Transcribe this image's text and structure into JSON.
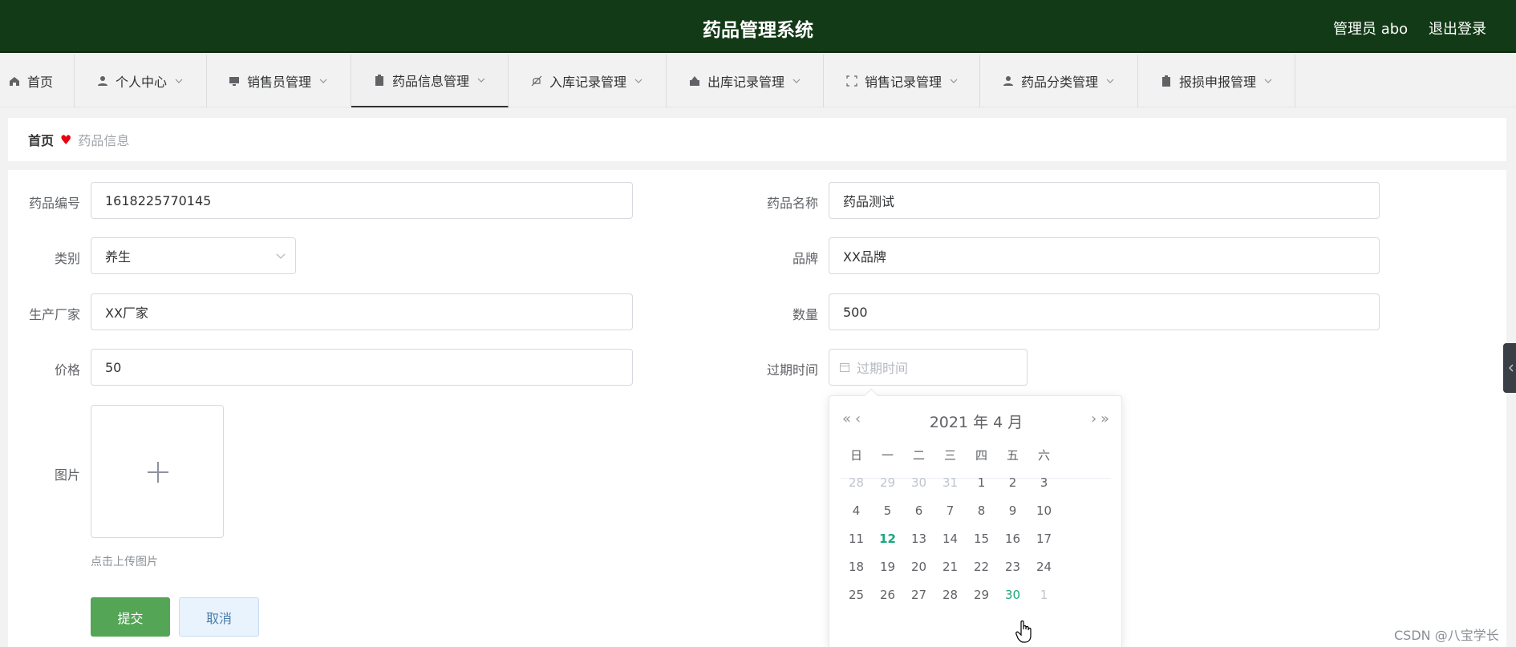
{
  "header": {
    "title": "药品管理系统",
    "user": "管理员 abo",
    "logout": "退出登录"
  },
  "nav": {
    "items": [
      {
        "label": "首页",
        "icon": "home-icon"
      },
      {
        "label": "个人中心",
        "icon": "user-icon"
      },
      {
        "label": "销售员管理",
        "icon": "monitor-icon"
      },
      {
        "label": "药品信息管理",
        "icon": "clipboard-icon"
      },
      {
        "label": "入库记录管理",
        "icon": "bell-off-icon"
      },
      {
        "label": "出库记录管理",
        "icon": "box-icon"
      },
      {
        "label": "销售记录管理",
        "icon": "fullscreen-icon"
      },
      {
        "label": "药品分类管理",
        "icon": "user-icon"
      },
      {
        "label": "报损申报管理",
        "icon": "clipboard-icon"
      }
    ]
  },
  "breadcrumb": {
    "home": "首页",
    "current": "药品信息"
  },
  "form": {
    "code_label": "药品编号",
    "code_value": "1618225770145",
    "name_label": "药品名称",
    "name_value": "药品测试",
    "category_label": "类别",
    "category_value": "养生",
    "brand_label": "品牌",
    "brand_value": "XX品牌",
    "maker_label": "生产厂家",
    "maker_value": "XX厂家",
    "qty_label": "数量",
    "qty_value": "500",
    "price_label": "价格",
    "price_value": "50",
    "expire_label": "过期时间",
    "expire_placeholder": "过期时间",
    "image_label": "图片",
    "upload_tip": "点击上传图片",
    "submit": "提交",
    "cancel": "取消"
  },
  "datepicker": {
    "prev_year": "«",
    "prev_month": "‹",
    "next_month": "›",
    "next_year": "»",
    "header": "2021 年  4 月",
    "weekdays": [
      "日",
      "一",
      "二",
      "三",
      "四",
      "五",
      "六"
    ],
    "weeks": [
      [
        "28",
        "29",
        "30",
        "31",
        "1",
        "2",
        "3"
      ],
      [
        "4",
        "5",
        "6",
        "7",
        "8",
        "9",
        "10"
      ],
      [
        "11",
        "12",
        "13",
        "14",
        "15",
        "16",
        "17"
      ],
      [
        "18",
        "19",
        "20",
        "21",
        "22",
        "23",
        "24"
      ],
      [
        "25",
        "26",
        "27",
        "28",
        "29",
        "30",
        "1"
      ]
    ],
    "today": "12",
    "highlight": "30"
  },
  "watermark": "CSDN @八宝学长",
  "colors": {
    "header_bg": "#133a17",
    "submit_bg": "#55a557",
    "accent": "#1aa87b",
    "heart": "#e60012"
  }
}
